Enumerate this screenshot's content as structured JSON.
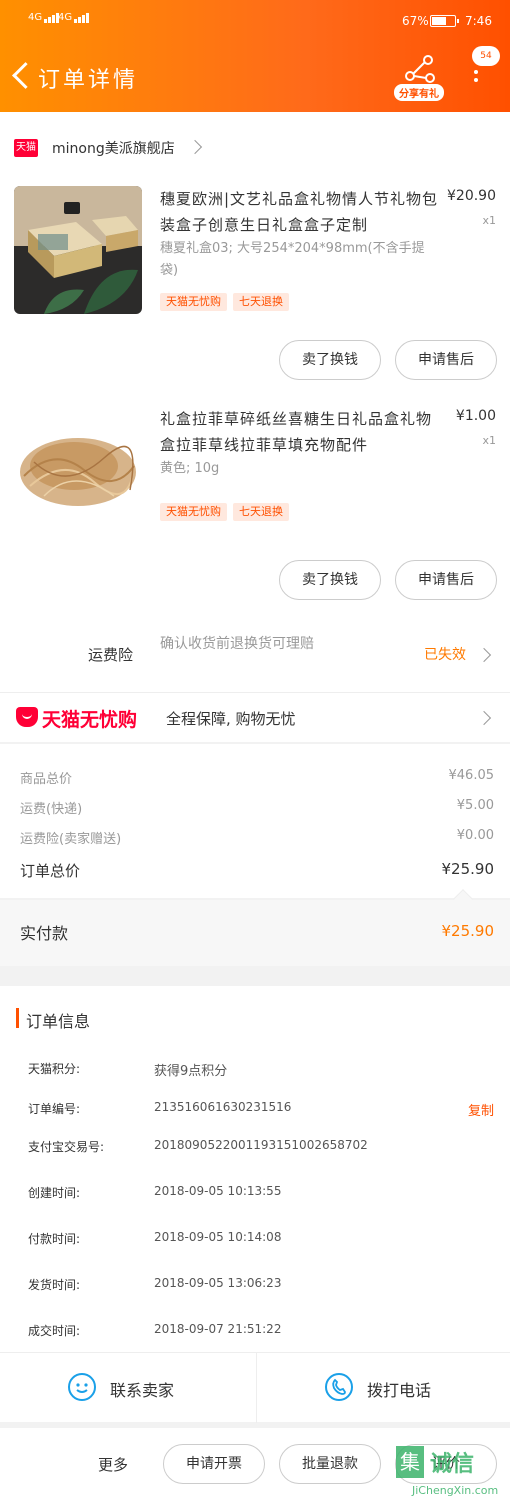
{
  "status_bar": {
    "signal1": "4G",
    "signal2": "4G",
    "battery": "67%",
    "battery_level": 0.67,
    "time": "7:46"
  },
  "header": {
    "title": "订单详情",
    "share_label": "分享有礼",
    "message_count": "54"
  },
  "store": {
    "badge": "天猫",
    "name": "minong美派旗舰店"
  },
  "products": [
    {
      "title": "穗夏欧洲|文艺礼品盒礼物情人节礼物包装盒子创意生日礼盒盒子定制",
      "sku": "穗夏礼盒03; 大号254*204*98mm(不含手提袋)",
      "tags": [
        "天猫无忧购",
        "七天退换"
      ],
      "price": "¥20.90",
      "qty": "x1",
      "btn_left": "卖了换钱",
      "btn_right": "申请售后"
    },
    {
      "title": "礼盒拉菲草碎纸丝喜糖生日礼品盒礼物盒拉菲草线拉菲草填充物配件",
      "sku": "黄色; 10g",
      "tags": [
        "天猫无忧购",
        "七天退换"
      ],
      "price": "¥1.00",
      "qty": "x1",
      "btn_left": "卖了换钱",
      "btn_right": "申请售后"
    }
  ],
  "freight_insurance": {
    "label": "运费险",
    "desc": "确认收货前退换货可理赔",
    "status": "已失效"
  },
  "wuyou": {
    "logo_text": "天猫无忧购",
    "desc": "全程保障, 购物无忧"
  },
  "summary": {
    "rows": [
      {
        "label": "商品总价",
        "value": "¥46.05"
      },
      {
        "label": "运费(快递)",
        "value": "¥5.00"
      },
      {
        "label": "运费险(卖家赠送)",
        "value": "¥0.00"
      },
      {
        "label": "订单总价",
        "value": "¥25.90"
      }
    ],
    "paid_label": "实付款",
    "paid_value": "¥25.90"
  },
  "order_info": {
    "title": "订单信息",
    "rows": [
      {
        "label": "天猫积分:",
        "value": "获得9点积分"
      },
      {
        "label": "订单编号:",
        "value": "213516061630231516",
        "action": "复制"
      },
      {
        "label": "支付宝交易号:",
        "value": "2018090522001193151002658702"
      },
      {
        "label": "创建时间:",
        "value": "2018-09-05 10:13:55"
      },
      {
        "label": "付款时间:",
        "value": "2018-09-05 10:14:08"
      },
      {
        "label": "发货时间:",
        "value": "2018-09-05 13:06:23"
      },
      {
        "label": "成交时间:",
        "value": "2018-09-07 21:51:22"
      }
    ]
  },
  "contact": {
    "seller": "联系卖家",
    "phone": "拨打电话"
  },
  "bottom_bar": {
    "more": "更多",
    "invoice": "申请开票",
    "batch_refund": "批量退款",
    "third": "评价"
  },
  "watermark": {
    "mark": "集",
    "text": "诚信",
    "url": "JiChengXin.com"
  },
  "colors": {
    "brand": "#ff5000",
    "tmall_red": "#ff0036",
    "accent_orange": "#ff7a00",
    "contact_blue": "#1aa0e8"
  }
}
